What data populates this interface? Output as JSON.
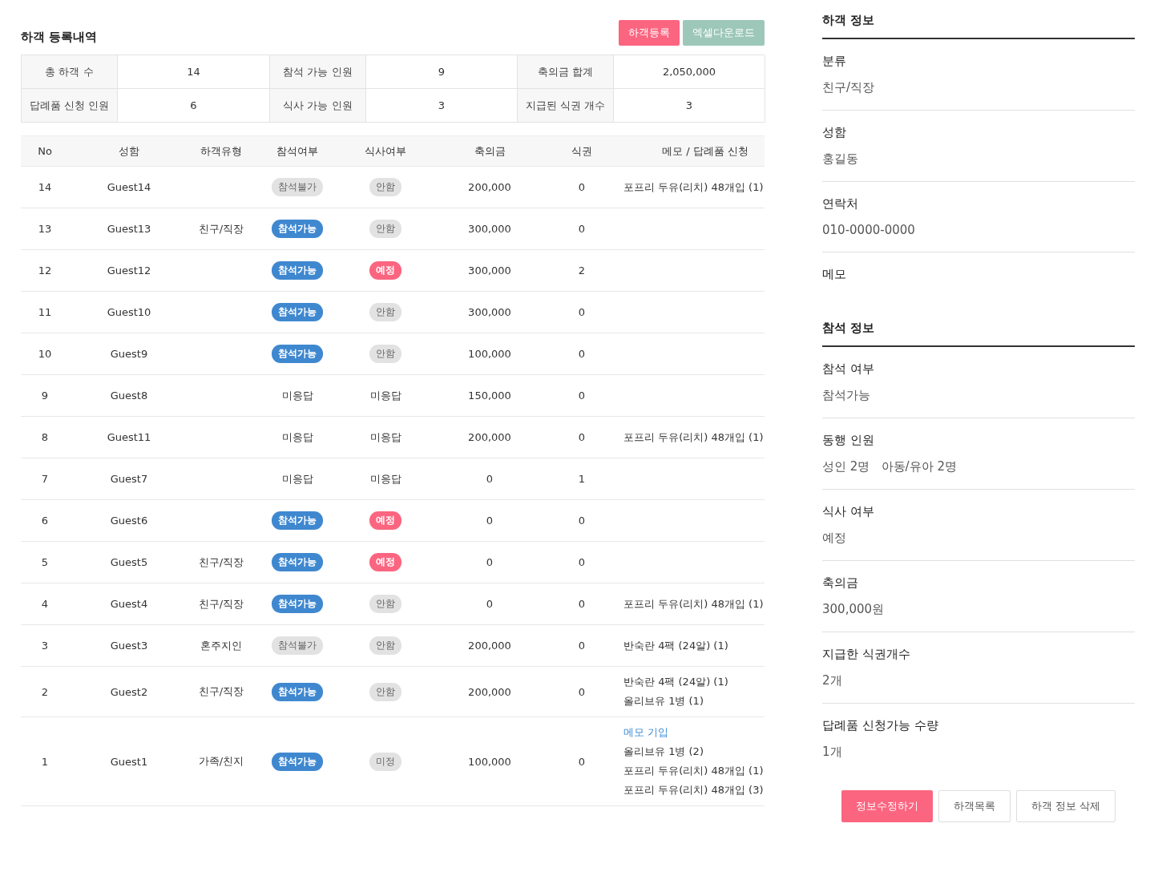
{
  "list_title": "하객 등록내역",
  "actions": [
    {
      "label": "하객등록",
      "kind": "primary"
    },
    {
      "label": "엑셀다운로드",
      "kind": "excel"
    }
  ],
  "summary": [
    [
      {
        "label": "총 하객 수",
        "value": "14"
      },
      {
        "label": "참석 가능 인원",
        "value": "9"
      },
      {
        "label": "축의금 합계",
        "value": "2,050,000"
      }
    ],
    [
      {
        "label": "답례품 신청 인원",
        "value": "6"
      },
      {
        "label": "식사 가능 인원",
        "value": "3"
      },
      {
        "label": "지급된 식권 개수",
        "value": "3"
      }
    ]
  ],
  "table": {
    "columns": [
      "No",
      "성함",
      "하객유형",
      "참석여부",
      "식사여부",
      "축의금",
      "식권",
      "메모 / 답례품 신청"
    ],
    "rows": [
      {
        "no": "14",
        "name": "Guest14",
        "type": "",
        "attend": {
          "kind": "grey",
          "label": "참석불가"
        },
        "meal": {
          "kind": "grey",
          "label": "안함"
        },
        "amount": "200,000",
        "tickets": "0",
        "memo": [
          {
            "kind": "text",
            "text": "포프리 두유(리치) 48개입 (1)"
          }
        ]
      },
      {
        "no": "13",
        "name": "Guest13",
        "type": "친구/직장",
        "attend": {
          "kind": "blue",
          "label": "참석가능"
        },
        "meal": {
          "kind": "grey",
          "label": "안함"
        },
        "amount": "300,000",
        "tickets": "0",
        "memo": []
      },
      {
        "no": "12",
        "name": "Guest12",
        "type": "",
        "attend": {
          "kind": "blue",
          "label": "참석가능"
        },
        "meal": {
          "kind": "pink",
          "label": "예정"
        },
        "amount": "300,000",
        "tickets": "2",
        "memo": []
      },
      {
        "no": "11",
        "name": "Guest10",
        "type": "",
        "attend": {
          "kind": "blue",
          "label": "참석가능"
        },
        "meal": {
          "kind": "grey",
          "label": "안함"
        },
        "amount": "300,000",
        "tickets": "0",
        "memo": []
      },
      {
        "no": "10",
        "name": "Guest9",
        "type": "",
        "attend": {
          "kind": "blue",
          "label": "참석가능"
        },
        "meal": {
          "kind": "grey",
          "label": "안함"
        },
        "amount": "100,000",
        "tickets": "0",
        "memo": []
      },
      {
        "no": "9",
        "name": "Guest8",
        "type": "",
        "attend": {
          "kind": "plain",
          "label": "미응답"
        },
        "meal": {
          "kind": "plain",
          "label": "미응답"
        },
        "amount": "150,000",
        "tickets": "0",
        "memo": []
      },
      {
        "no": "8",
        "name": "Guest11",
        "type": "",
        "attend": {
          "kind": "plain",
          "label": "미응답"
        },
        "meal": {
          "kind": "plain",
          "label": "미응답"
        },
        "amount": "200,000",
        "tickets": "0",
        "memo": [
          {
            "kind": "text",
            "text": "포프리 두유(리치) 48개입 (1)"
          }
        ]
      },
      {
        "no": "7",
        "name": "Guest7",
        "type": "",
        "attend": {
          "kind": "plain",
          "label": "미응답"
        },
        "meal": {
          "kind": "plain",
          "label": "미응답"
        },
        "amount": "0",
        "tickets": "1",
        "memo": []
      },
      {
        "no": "6",
        "name": "Guest6",
        "type": "",
        "attend": {
          "kind": "blue",
          "label": "참석가능"
        },
        "meal": {
          "kind": "pink",
          "label": "예정"
        },
        "amount": "0",
        "tickets": "0",
        "memo": []
      },
      {
        "no": "5",
        "name": "Guest5",
        "type": "친구/직장",
        "attend": {
          "kind": "blue",
          "label": "참석가능"
        },
        "meal": {
          "kind": "pink",
          "label": "예정"
        },
        "amount": "0",
        "tickets": "0",
        "memo": []
      },
      {
        "no": "4",
        "name": "Guest4",
        "type": "친구/직장",
        "attend": {
          "kind": "blue",
          "label": "참석가능"
        },
        "meal": {
          "kind": "grey",
          "label": "안함"
        },
        "amount": "0",
        "tickets": "0",
        "memo": [
          {
            "kind": "text",
            "text": "포프리 두유(리치) 48개입 (1)"
          }
        ]
      },
      {
        "no": "3",
        "name": "Guest3",
        "type": "혼주지인",
        "attend": {
          "kind": "grey",
          "label": "참석불가"
        },
        "meal": {
          "kind": "grey",
          "label": "안함"
        },
        "amount": "200,000",
        "tickets": "0",
        "memo": [
          {
            "kind": "text",
            "text": "반숙란 4팩 (24알) (1)"
          }
        ]
      },
      {
        "no": "2",
        "name": "Guest2",
        "type": "친구/직장",
        "attend": {
          "kind": "blue",
          "label": "참석가능"
        },
        "meal": {
          "kind": "grey",
          "label": "안함"
        },
        "amount": "200,000",
        "tickets": "0",
        "memo": [
          {
            "kind": "text",
            "text": "반숙란 4팩 (24알) (1)"
          },
          {
            "kind": "text",
            "text": "올리브유 1병 (1)"
          }
        ]
      },
      {
        "no": "1",
        "name": "Guest1",
        "type": "가족/친지",
        "attend": {
          "kind": "blue",
          "label": "참석가능"
        },
        "meal": {
          "kind": "grey",
          "label": "미정"
        },
        "amount": "100,000",
        "tickets": "0",
        "memo": [
          {
            "kind": "link",
            "text": "메모 기입"
          },
          {
            "kind": "text",
            "text": "올리브유 1병 (2)"
          },
          {
            "kind": "text",
            "text": "포프리 두유(리치) 48개입 (1)"
          },
          {
            "kind": "text",
            "text": "포프리 두유(리치) 48개입 (3)"
          }
        ]
      }
    ]
  },
  "detail_sections": [
    {
      "title": "하객 정보",
      "fields": [
        {
          "label": "분류",
          "value": "친구/직장"
        },
        {
          "label": "성함",
          "value": "홍길동"
        },
        {
          "label": "연락처",
          "value": "010-0000-0000"
        },
        {
          "label": "메모"
        }
      ]
    },
    {
      "title": "참석 정보",
      "fields": [
        {
          "label": "참석 여부",
          "value": "참석가능"
        },
        {
          "label": "동행 인원",
          "value": "성인 2명   아동/유아 2명"
        },
        {
          "label": "식사 여부",
          "value": "예정"
        },
        {
          "label": "축의금",
          "value": "300,000원"
        },
        {
          "label": "지급한 식권개수",
          "value": "2개"
        },
        {
          "label": "답례품 신청가능 수량",
          "value": "1개"
        }
      ]
    }
  ],
  "detail_buttons": [
    {
      "label": "정보수정하기",
      "kind": "primary"
    },
    {
      "label": "하객목록",
      "kind": "outline"
    },
    {
      "label": "하객 정보 삭제",
      "kind": "outline"
    }
  ]
}
